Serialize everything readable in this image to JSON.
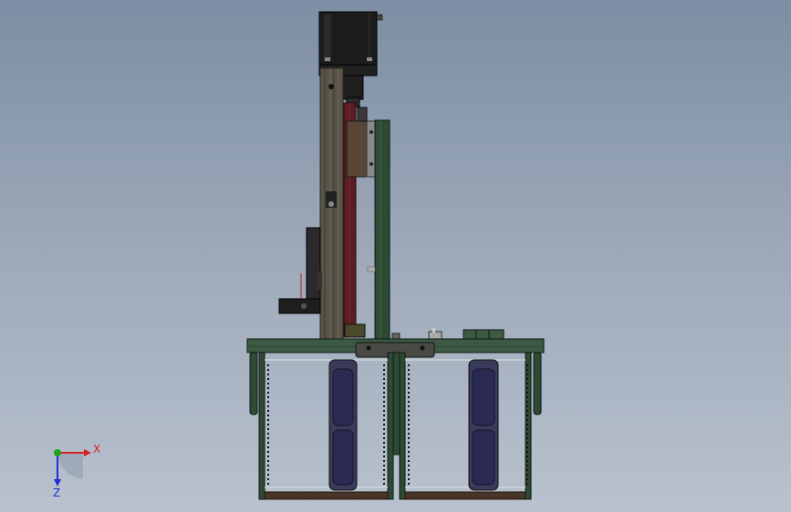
{
  "triad": {
    "x_label": "X",
    "z_label": "Z",
    "x_color": "#d61f1f",
    "y_color": "#1fa31f",
    "z_color": "#1f2fd6"
  },
  "colors": {
    "background_top": "#7d8da3",
    "background_bottom": "#b9c2ce",
    "frame_green": "#2e4a35",
    "plate_green": "#3c5a43",
    "aluminum_profile": "#5a5448",
    "motor_black": "#1c1c1c",
    "belt_red": "#5a1e22",
    "carriage_brown": "#5a4636",
    "cylinder_navy": "#2a2a52",
    "base_brown": "#4a3628"
  }
}
